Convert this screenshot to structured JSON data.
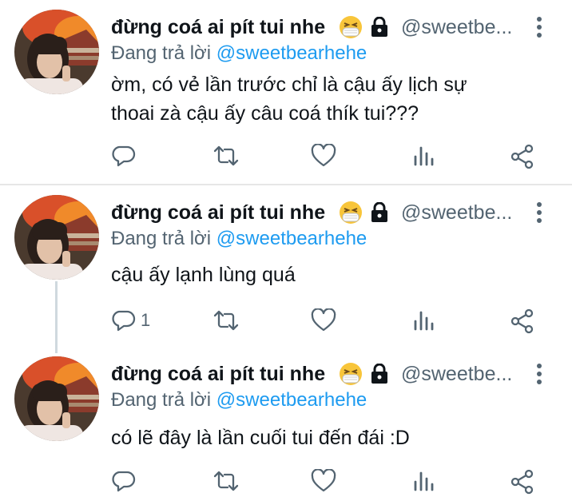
{
  "tweets": [
    {
      "author_name": "đừng coá ai pít tui nhe",
      "emoji": "face-with-medical-mask-squinting-emoji",
      "lock_icon": "lock-icon",
      "handle": "@sweetbe...",
      "replying_prefix": "Đang trả lời",
      "replying_to": "@sweetbearhehe",
      "text_line1": "ờm, có vẻ lần trước chỉ là cậu ấy lịch sự",
      "text_line2": "thoai zà cậu ấy câu coá thík tui???",
      "reply_count": ""
    },
    {
      "author_name": "đừng coá ai pít tui nhe",
      "emoji": "face-with-medical-mask-squinting-emoji",
      "lock_icon": "lock-icon",
      "handle": "@sweetbe...",
      "replying_prefix": "Đang trả lời",
      "replying_to": "@sweetbearhehe",
      "text_line1": "cậu ấy lạnh lùng quá",
      "text_line2": "",
      "reply_count": "1"
    },
    {
      "author_name": "đừng coá ai pít tui nhe",
      "emoji": "face-with-medical-mask-squinting-emoji",
      "lock_icon": "lock-icon",
      "handle": "@sweetbe...",
      "replying_prefix": "Đang trả lời",
      "replying_to": "@sweetbearhehe",
      "text_line1": "có lẽ đây là lần cuối tui đến đái :D",
      "text_line2": "",
      "reply_count": ""
    }
  ],
  "colors": {
    "text": "#0f1419",
    "secondary": "#536471",
    "mention": "#1d9bf0",
    "divider": "#e6e6e6"
  }
}
